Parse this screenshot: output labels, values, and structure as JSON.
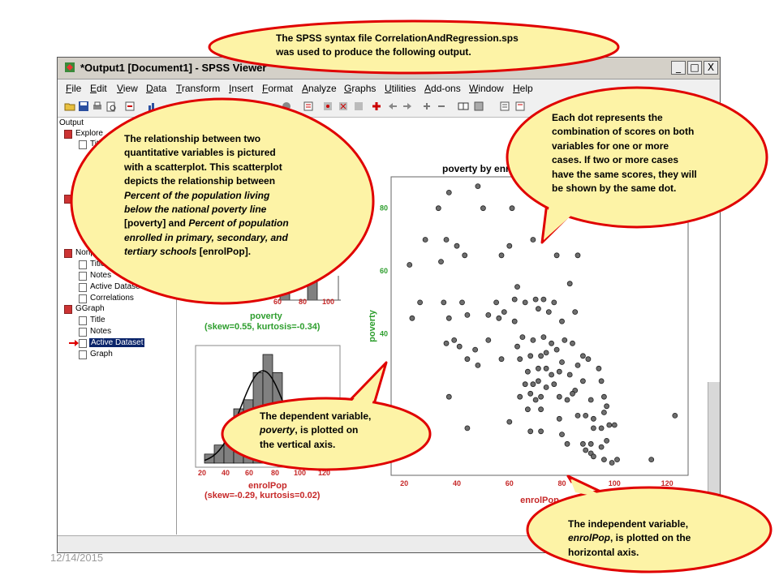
{
  "window": {
    "title": "*Output1 [Document1] - SPSS Viewer",
    "buttons": {
      "minimize": "_",
      "maximize": "□",
      "close": "X"
    }
  },
  "menu": [
    "File",
    "Edit",
    "View",
    "Data",
    "Transform",
    "Insert",
    "Format",
    "Analyze",
    "Graphs",
    "Utilities",
    "Add-ons",
    "Window",
    "Help"
  ],
  "outline": {
    "root": "Output",
    "explore": "Explore",
    "explore_child": "Title",
    "nonpar": "Nonp",
    "nonpar_children": [
      "Title",
      "Notes",
      "Active Dataset",
      "Correlations"
    ],
    "ggraph": "GGraph",
    "ggraph_children": [
      "Title",
      "Notes",
      "Active Dataset",
      "Graph"
    ]
  },
  "histograms": {
    "poverty": {
      "label": "poverty",
      "stats": "(skew=0.55, kurtosis=-0.34)",
      "ticks": [
        "60",
        "80",
        "100"
      ]
    },
    "enrolpop": {
      "label": "enrolPop",
      "stats": "(skew=-0.29, kurtosis=0.02)",
      "ticks": [
        "20",
        "40",
        "60",
        "80",
        "100",
        "120"
      ],
      "bars": [
        1,
        2,
        4,
        6,
        7,
        10,
        12,
        10,
        6,
        4,
        2
      ]
    }
  },
  "chart_data": {
    "type": "scatter",
    "title": "poverty by enrolPop",
    "xlabel": "enrolPop",
    "ylabel": "poverty",
    "xlim": [
      15,
      128
    ],
    "ylim": [
      -5,
      90
    ],
    "xticks": [
      20,
      40,
      60,
      80,
      100,
      120
    ],
    "yticks": [
      40,
      60,
      80
    ],
    "points": [
      [
        37,
        85
      ],
      [
        48,
        87
      ],
      [
        33,
        80
      ],
      [
        50,
        80
      ],
      [
        61,
        80
      ],
      [
        28,
        70
      ],
      [
        36,
        70
      ],
      [
        40,
        68
      ],
      [
        60,
        68
      ],
      [
        69,
        70
      ],
      [
        22,
        62
      ],
      [
        34,
        63
      ],
      [
        43,
        65
      ],
      [
        57,
        65
      ],
      [
        78,
        65
      ],
      [
        86,
        65
      ],
      [
        26,
        50
      ],
      [
        35,
        50
      ],
      [
        42,
        50
      ],
      [
        55,
        50
      ],
      [
        56,
        45
      ],
      [
        62,
        51
      ],
      [
        63,
        55
      ],
      [
        66,
        50
      ],
      [
        70,
        51
      ],
      [
        73,
        51
      ],
      [
        77,
        50
      ],
      [
        83,
        56
      ],
      [
        23,
        45
      ],
      [
        37,
        45
      ],
      [
        44,
        46
      ],
      [
        52,
        46
      ],
      [
        58,
        47
      ],
      [
        62,
        44
      ],
      [
        71,
        48
      ],
      [
        75,
        47
      ],
      [
        80,
        44
      ],
      [
        85,
        47
      ],
      [
        36,
        37
      ],
      [
        39,
        38
      ],
      [
        41,
        36
      ],
      [
        47,
        35
      ],
      [
        52,
        38
      ],
      [
        63,
        36
      ],
      [
        65,
        39
      ],
      [
        69,
        38
      ],
      [
        73,
        39
      ],
      [
        76,
        37
      ],
      [
        81,
        38
      ],
      [
        84,
        37
      ],
      [
        44,
        32
      ],
      [
        48,
        30
      ],
      [
        57,
        32
      ],
      [
        64,
        32
      ],
      [
        68,
        33
      ],
      [
        72,
        33
      ],
      [
        74,
        34
      ],
      [
        78,
        35
      ],
      [
        80,
        31
      ],
      [
        88,
        33
      ],
      [
        90,
        32
      ],
      [
        67,
        28
      ],
      [
        71,
        29
      ],
      [
        74,
        29
      ],
      [
        76,
        27
      ],
      [
        79,
        28
      ],
      [
        83,
        27
      ],
      [
        86,
        30
      ],
      [
        94,
        29
      ],
      [
        66,
        24
      ],
      [
        69,
        24
      ],
      [
        71,
        25
      ],
      [
        74,
        23
      ],
      [
        77,
        24
      ],
      [
        85,
        22
      ],
      [
        88,
        25
      ],
      [
        95,
        25
      ],
      [
        37,
        20
      ],
      [
        64,
        20
      ],
      [
        68,
        21
      ],
      [
        70,
        19
      ],
      [
        72,
        20
      ],
      [
        79,
        20
      ],
      [
        82,
        19
      ],
      [
        84,
        21
      ],
      [
        91,
        19
      ],
      [
        96,
        20
      ],
      [
        89,
        14
      ],
      [
        92,
        13
      ],
      [
        97,
        17
      ],
      [
        67,
        16
      ],
      [
        72,
        16
      ],
      [
        79,
        13
      ],
      [
        86,
        14
      ],
      [
        92,
        10
      ],
      [
        95,
        10
      ],
      [
        96,
        15
      ],
      [
        98,
        11
      ],
      [
        100,
        11
      ],
      [
        44,
        10
      ],
      [
        60,
        12
      ],
      [
        68,
        9
      ],
      [
        72,
        9
      ],
      [
        80,
        8
      ],
      [
        82,
        5
      ],
      [
        88,
        5
      ],
      [
        91,
        5
      ],
      [
        95,
        4
      ],
      [
        97,
        6
      ],
      [
        89,
        3
      ],
      [
        91,
        2
      ],
      [
        92,
        1
      ],
      [
        96,
        0
      ],
      [
        99,
        -1
      ],
      [
        101,
        0
      ],
      [
        114,
        0
      ],
      [
        123,
        14
      ]
    ]
  },
  "callouts": {
    "top": [
      "The SPSS syntax file CorrelationAndRegression.sps",
      "was used to produce the following output."
    ],
    "left": [
      [
        {
          "t": "The relationship between two",
          "i": false
        }
      ],
      [
        {
          "t": "quantitative variables is pictured",
          "i": false
        }
      ],
      [
        {
          "t": "with a scatterplot. This scatterplot",
          "i": false
        }
      ],
      [
        {
          "t": "depicts the relationship between",
          "i": false
        }
      ],
      [
        {
          "t": "Percent of the population  living",
          "i": true
        }
      ],
      [
        {
          "t": "below the national poverty line",
          "i": true
        }
      ],
      [
        {
          "t": "[poverty] and ",
          "i": false
        },
        {
          "t": "Percent of population",
          "i": true
        }
      ],
      [
        {
          "t": "enrolled in primary, secondary, and",
          "i": true
        }
      ],
      [
        {
          "t": "tertiary schools",
          "i": true
        },
        {
          "t": " [enrolPop].",
          "i": false
        }
      ]
    ],
    "right": [
      "Each dot represents the",
      "combination of scores on both",
      "variables for one or more",
      "cases. If two or more cases",
      "have the same scores, they will",
      "be shown by the same dot."
    ],
    "dependent": [
      [
        {
          "t": "The dependent variable,",
          "i": false
        }
      ],
      [
        {
          "t": "poverty",
          "i": true
        },
        {
          "t": ", is plotted on",
          "i": false
        }
      ],
      [
        {
          "t": "the vertical axis.",
          "i": false
        }
      ]
    ],
    "independent": [
      [
        {
          "t": "The independent variable,",
          "i": false
        }
      ],
      [
        {
          "t": "enrolPop",
          "i": true
        },
        {
          "t": ", is plotted on the",
          "i": false
        }
      ],
      [
        {
          "t": "horizontal axis.",
          "i": false
        }
      ]
    ]
  },
  "date": "12/14/2015",
  "colors": {
    "callout_fill": "#fdf3a6",
    "callout_border": "#e00000",
    "axis_red": "#c62828",
    "axis_green": "#2e9e2e"
  }
}
